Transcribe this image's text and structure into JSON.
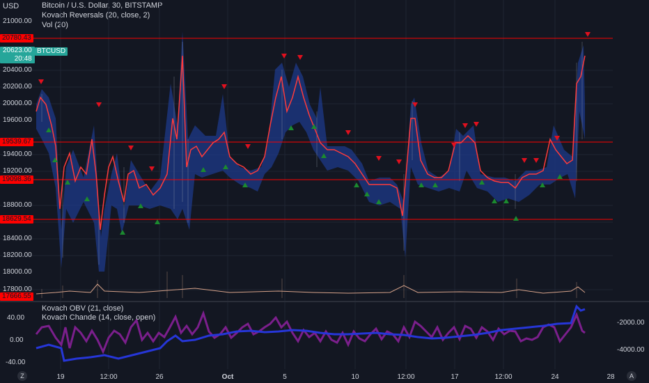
{
  "header": {
    "currency": "USD",
    "title": "Bitcoin / U.S. Dollar, 30, BITSTAMP",
    "indicator1": "Kovach Reversals (20, close, 2)",
    "indicator2": "Vol (20)"
  },
  "price_axis": [
    "21000.00",
    "20400.00",
    "20200.00",
    "20000.00",
    "19600.00",
    "19400.00",
    "19200.00",
    "18800.00",
    "18600.00",
    "18400.00",
    "18200.00",
    "18000.00",
    "17800.00"
  ],
  "price_tags": {
    "level1": "20780.43",
    "current": "20623.00",
    "countdown": "20:48",
    "symbol": "BTCUSD",
    "level2": "19539.67",
    "level3": "19098.36",
    "level4": "18629.54",
    "low": "17666.55"
  },
  "oscillator": {
    "label1": "Kovach OBV (21, close)",
    "label2": "Kovach Chande (14, close, open)",
    "left_axis": [
      "40.00",
      "0.00",
      "-40.00"
    ],
    "right_axis": [
      "-2000.00",
      "-4000.00"
    ]
  },
  "time_axis": [
    "19",
    "12:00",
    "26",
    "Oct",
    "5",
    "10",
    "12:00",
    "17",
    "12:00",
    "24",
    "28"
  ],
  "footer_icons": {
    "left": "Z",
    "right": "A"
  },
  "colors": {
    "background": "#131722",
    "level_line": "#ff0000",
    "price_line": "#ff3b3b",
    "band": "#1e3a8a",
    "up_marker": "#1b8a2f",
    "down_marker": "#e0101e",
    "obv_line": "#2636d8",
    "chande_line": "#7b1f8c",
    "volume": "#d7a38a"
  }
}
